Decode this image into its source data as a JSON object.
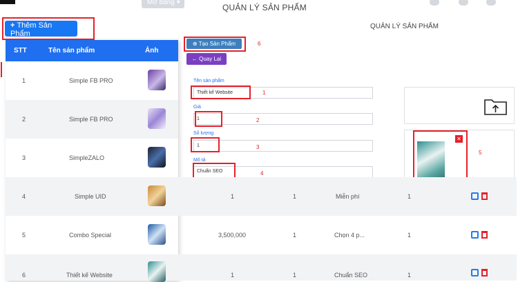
{
  "header": {
    "title": "QUẢN LÝ SẢN PHẨM",
    "dropdown_label": "Mở bảng"
  },
  "add_button_label": "Thêm Sản Phẩm",
  "table": {
    "columns": [
      "STT",
      "Tên sản phẩm",
      "Ảnh"
    ],
    "rows": [
      {
        "stt": "1",
        "name": "Simple FB PRO"
      },
      {
        "stt": "2",
        "name": "Simple FB PRO"
      },
      {
        "stt": "3",
        "name": "SimpleZALO"
      },
      {
        "stt": "4",
        "name": "Simple UID",
        "price": "1",
        "qty": "1",
        "desc": "Miễn phí",
        "extra": "1"
      },
      {
        "stt": "5",
        "name": "Combo Special",
        "price": "3,500,000",
        "qty": "1",
        "desc": "Chọn 4 p...",
        "extra": "1"
      },
      {
        "stt": "6",
        "name": "Thiết kế Website",
        "price": "1",
        "qty": "1",
        "desc": "Chuẩn SEO",
        "extra": "1"
      }
    ]
  },
  "form": {
    "title": "QUẢN LÝ SẢN PHẨM",
    "create_button": "Tạo Sản Phẩm",
    "back_button": "Quay Lại",
    "name_label": "Tên sản phẩm",
    "name_value": "Thiết kế Website",
    "price_label": "Giá",
    "price_value": "1",
    "qty_label": "Số lượng",
    "qty_value": "1",
    "desc_label": "Mô tả",
    "desc_value": "Chuẩn SEO"
  },
  "annotations": [
    "1",
    "2",
    "3",
    "4",
    "5",
    "6"
  ],
  "colors": {
    "primary": "#1877f2",
    "header_blue": "#1f6ff0",
    "back_purple": "#7b3fc1",
    "create_blue": "#3d7fbe",
    "annotation_red": "#e5202a"
  }
}
